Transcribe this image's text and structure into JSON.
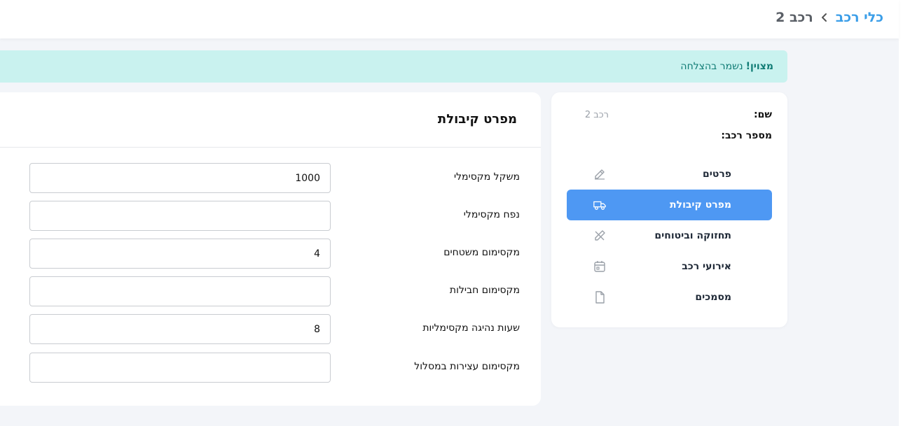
{
  "breadcrumb": {
    "parent": "כלי רכב",
    "current": "רכב 2"
  },
  "alert": {
    "title": "מצוין!",
    "message": "נשמר בהצלחה"
  },
  "vehicle": {
    "name_label": "שם:",
    "name_value": "רכב 2",
    "number_label": "מספר רכב:"
  },
  "nav": {
    "items": [
      {
        "label": "פרטים",
        "icon": "edit-icon"
      },
      {
        "label": "מפרט קיבולת",
        "icon": "truck-icon",
        "active": true
      },
      {
        "label": "תחזוקה וביטוחים",
        "icon": "tools-icon"
      },
      {
        "label": "אירועי רכב",
        "icon": "calendar-icon"
      },
      {
        "label": "מסמכים",
        "icon": "document-icon"
      }
    ]
  },
  "main": {
    "title": "מפרט קיבולת",
    "fields": [
      {
        "label": "משקל מקסימלי",
        "value": "1000"
      },
      {
        "label": "נפח מקסימלי",
        "value": ""
      },
      {
        "label": "מקסימום משטחים",
        "value": "4"
      },
      {
        "label": "מקסימום חבילות",
        "value": ""
      },
      {
        "label": "שעות נהיגה מקסימליות",
        "value": "8"
      },
      {
        "label": "מקסימום עצירות במסלול",
        "value": ""
      }
    ]
  },
  "colors": {
    "accent": "#4e98f3",
    "link": "#3b9ee8",
    "alert_bg": "#c9f2ef",
    "alert_text": "#0f7b74"
  }
}
